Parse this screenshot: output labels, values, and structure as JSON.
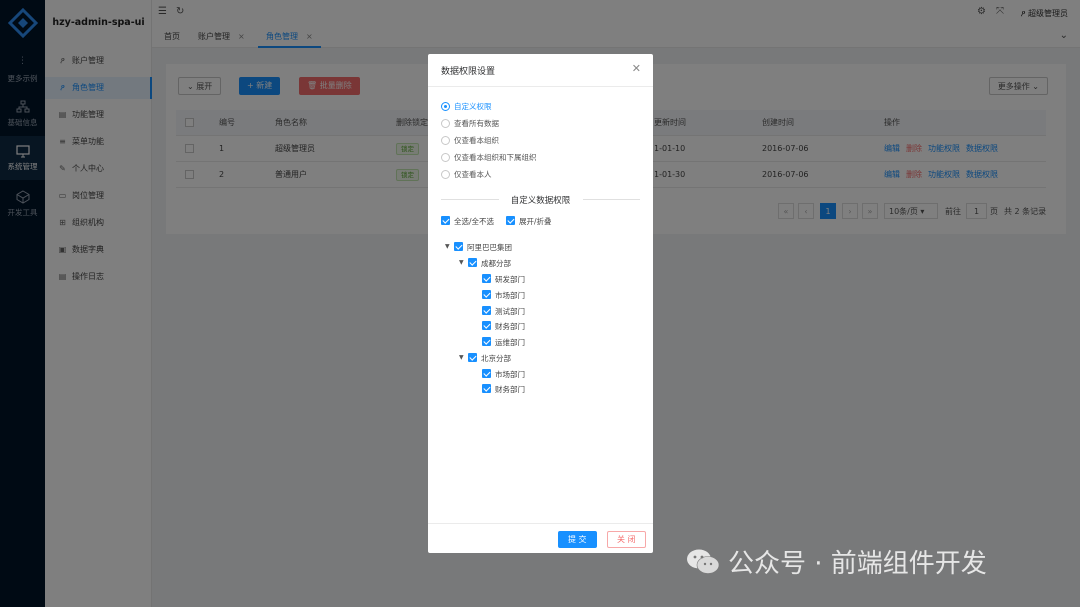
{
  "rail": {
    "dots": "⋮",
    "items": [
      {
        "label": "更多示例"
      },
      {
        "label": "基础信息"
      },
      {
        "label": "系统管理"
      },
      {
        "label": "开发工具"
      }
    ]
  },
  "app": {
    "title": "hzy-admin-spa-ui"
  },
  "sidebar": {
    "items": [
      {
        "label": "账户管理",
        "icon": "user-icon"
      },
      {
        "label": "角色管理",
        "icon": "role-icon"
      },
      {
        "label": "功能管理",
        "icon": "function-icon"
      },
      {
        "label": "菜单功能",
        "icon": "menu-icon"
      },
      {
        "label": "个人中心",
        "icon": "edit-icon"
      },
      {
        "label": "岗位管理",
        "icon": "post-icon"
      },
      {
        "label": "组织机构",
        "icon": "org-icon"
      },
      {
        "label": "数据字典",
        "icon": "dict-icon"
      },
      {
        "label": "操作日志",
        "icon": "log-icon"
      }
    ]
  },
  "topbar": {
    "user": "超级管理员"
  },
  "tabs": [
    {
      "label": "首页"
    },
    {
      "label": "账户管理"
    },
    {
      "label": "角色管理"
    }
  ],
  "toolbar": {
    "expand": "展开",
    "new": "+ 新建",
    "batch_delete": "批量删除",
    "more": "更多操作"
  },
  "table": {
    "headers": [
      "编号",
      "角色名称",
      "删除锁定",
      "更新时间",
      "创建时间",
      "操作"
    ],
    "rows": [
      {
        "id": "1",
        "name": "超级管理员",
        "locked": "锁定",
        "updated": "1-01-10",
        "created": "2016-07-06"
      },
      {
        "id": "2",
        "name": "普通用户",
        "locked": "锁定",
        "updated": "1-01-30",
        "created": "2016-07-06"
      }
    ],
    "ops": {
      "edit": "编辑",
      "delete": "删除",
      "func": "功能权限",
      "data": "数据权限"
    }
  },
  "pager": {
    "current": "1",
    "size": "10条/页",
    "goto": "前往",
    "page_input": "1",
    "page_unit": "页",
    "total": "共 2 条记录"
  },
  "modal": {
    "title": "数据权限设置",
    "options": [
      {
        "label": "自定义权限",
        "checked": true
      },
      {
        "label": "查看所有数据",
        "checked": false
      },
      {
        "label": "仅查看本组织",
        "checked": false
      },
      {
        "label": "仅查看本组织和下属组织",
        "checked": false
      },
      {
        "label": "仅查看本人",
        "checked": false
      }
    ],
    "section": "自定义数据权限",
    "select_all": "全选/全不选",
    "expand_collapse": "展开/折叠",
    "tree": {
      "root": "阿里巴巴集团",
      "branch1": "成都分部",
      "branch1_items": [
        "研发部门",
        "市场部门",
        "测试部门",
        "财务部门",
        "运维部门"
      ],
      "branch2": "北京分部",
      "branch2_items": [
        "市场部门",
        "财务部门"
      ]
    },
    "submit": "提 交",
    "close": "关 闭"
  },
  "watermark": "公众号 · 前端组件开发",
  "colors": {
    "primary": "#1890ff",
    "danger": "#f56c6c",
    "rail": "#001529"
  }
}
